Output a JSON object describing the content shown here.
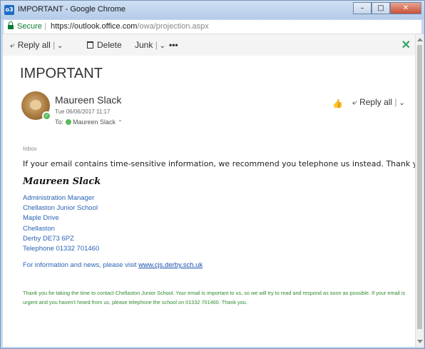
{
  "window": {
    "title": "IMPORTANT - Google Chrome",
    "app_icon_text": "o3"
  },
  "address_bar": {
    "secure_label": "Secure",
    "url_host": "https://outlook.office.com",
    "url_path": "/owa/projection.aspx"
  },
  "toolbar": {
    "reply_all_label": "Reply all",
    "delete_label": "Delete",
    "junk_label": "Junk",
    "more_label": "•••",
    "close_label": "✕"
  },
  "message": {
    "subject": "IMPORTANT",
    "sender_name": "Maureen Slack",
    "sent_date": "Tue 06/06/2017 11:17",
    "to_label": "To:",
    "to_name": "Maureen Slack",
    "reply_all_label": "Reply all",
    "folder": "Inbox",
    "body": "If your email contains time-sensitive information, we recommend you telephone us instead. Thank you!"
  },
  "signature": {
    "name": "Maureen Slack",
    "lines": [
      "Administration Manager",
      "Chellaston Junior School",
      "Maple Drive",
      "Chellaston",
      "Derby DE73 6PZ",
      "Telephone 01332 701460"
    ],
    "info_text": "For information and news, please visit ",
    "info_link": "www.cjs.derby.sch.uk",
    "footer": "Thank you for taking the time to contact Chellaston Junior School. Your email is important to us, so we will try to read and respond as soon as possible.  If your email is urgent and you haven't heard from us, please telephone the school on 01332 701460. Thank you."
  },
  "colors": {
    "accent_green": "#2fa364",
    "signature_blue": "#2a64b4",
    "footer_green": "#2e8b2e"
  }
}
